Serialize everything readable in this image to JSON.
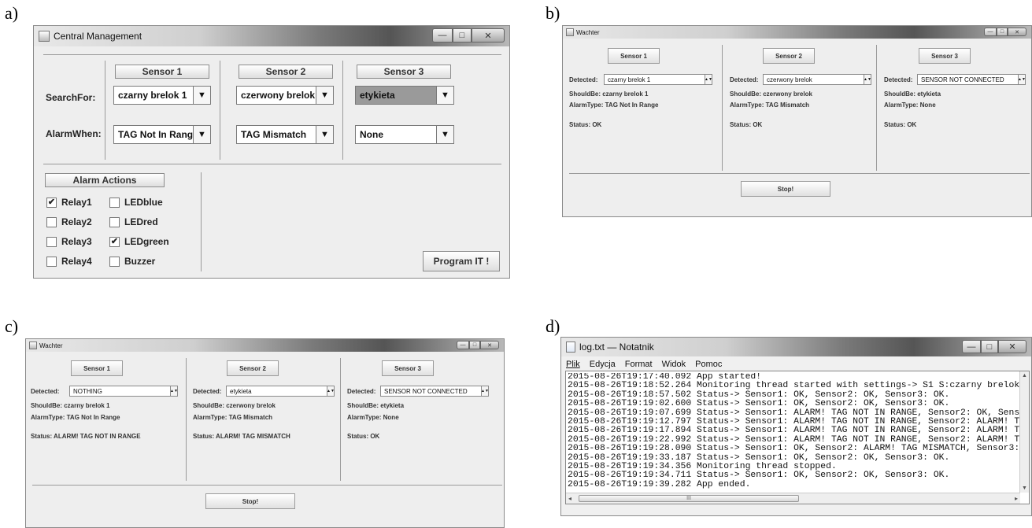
{
  "panels": {
    "a": "a)",
    "b": "b)",
    "c": "c)",
    "d": "d)"
  },
  "central": {
    "title": "Central Management",
    "sensors": [
      {
        "label": "Sensor 1",
        "search": "czarny brelok 1",
        "alarm": "TAG Not In Range"
      },
      {
        "label": "Sensor 2",
        "search": "czerwony brelok",
        "alarm": "TAG Mismatch"
      },
      {
        "label": "Sensor 3",
        "search": "etykieta",
        "alarm": "None"
      }
    ],
    "search_for_label": "SearchFor:",
    "alarm_when_label": "AlarmWhen:",
    "alarm_actions_label": "Alarm Actions",
    "checkboxes": [
      {
        "label": "Relay1",
        "checked": true
      },
      {
        "label": "LEDblue",
        "checked": false
      },
      {
        "label": "Relay2",
        "checked": false
      },
      {
        "label": "LEDred",
        "checked": false
      },
      {
        "label": "Relay3",
        "checked": false
      },
      {
        "label": "LEDgreen",
        "checked": true
      },
      {
        "label": "Relay4",
        "checked": false
      },
      {
        "label": "Buzzer",
        "checked": false
      }
    ],
    "program_label": "Program IT !"
  },
  "wachter_b": {
    "title": "Wachter",
    "stop_label": "Stop!",
    "columns": [
      {
        "sensor": "Sensor 1",
        "detected_label": "Detected:",
        "detected": "czarny brelok 1",
        "shouldbe": "ShouldBe:  czarny brelok 1",
        "alarmtype": "AlarmType:   TAG Not In Range",
        "status": "Status:  OK"
      },
      {
        "sensor": "Sensor 2",
        "detected_label": "Detected:",
        "detected": "czerwony brelok",
        "shouldbe": "ShouldBe: czerwony brelok",
        "alarmtype": "AlarmType:   TAG Mismatch",
        "status": "Status:  OK"
      },
      {
        "sensor": "Sensor 3",
        "detected_label": "Detected:",
        "detected": "SENSOR NOT CONNECTED",
        "shouldbe": "ShouldBe:  etykieta",
        "alarmtype": "AlarmType:   None",
        "status": "Status:  OK"
      }
    ]
  },
  "wachter_c": {
    "title": "Wachter",
    "stop_label": "Stop!",
    "columns": [
      {
        "sensor": "Sensor 1",
        "detected_label": "Detected:",
        "detected": "NOTHING",
        "shouldbe": "ShouldBe:  czarny brelok 1",
        "alarmtype": "AlarmType:   TAG Not In Range",
        "status": "Status:  ALARM! TAG NOT IN RANGE"
      },
      {
        "sensor": "Sensor 2",
        "detected_label": "Detected:",
        "detected": "etykieta",
        "shouldbe": "ShouldBe: czerwony brelok",
        "alarmtype": "AlarmType:   TAG Mismatch",
        "status": "Status:  ALARM! TAG MISMATCH"
      },
      {
        "sensor": "Sensor 3",
        "detected_label": "Detected:",
        "detected": "SENSOR NOT CONNECTED",
        "shouldbe": "ShouldBe:  etykieta",
        "alarmtype": "AlarmType:   None",
        "status": "Status:  OK"
      }
    ]
  },
  "notepad": {
    "title": "log.txt — Notatnik",
    "menu": [
      "Plik",
      "Edycja",
      "Format",
      "Widok",
      "Pomoc"
    ],
    "lines": [
      "2015-08-26T19:17:40.092 App started!",
      "2015-08-26T19:18:52.264 Monitoring thread started with settings-> S1 S:czarny brelok",
      "2015-08-26T19:18:57.502 Status-> Sensor1: OK, Sensor2: OK, Sensor3: OK.",
      "2015-08-26T19:19:02.600 Status-> Sensor1: OK, Sensor2: OK, Sensor3: OK.",
      "2015-08-26T19:19:07.699 Status-> Sensor1: ALARM! TAG NOT IN RANGE, Sensor2: OK, Sens",
      "2015-08-26T19:19:12.797 Status-> Sensor1: ALARM! TAG NOT IN RANGE, Sensor2: ALARM! T",
      "2015-08-26T19:19:17.894 Status-> Sensor1: ALARM! TAG NOT IN RANGE, Sensor2: ALARM! T",
      "2015-08-26T19:19:22.992 Status-> Sensor1: ALARM! TAG NOT IN RANGE, Sensor2: ALARM! T",
      "2015-08-26T19:19:28.090 Status-> Sensor1: OK, Sensor2: ALARM! TAG MISMATCH, Sensor3:",
      "2015-08-26T19:19:33.187 Status-> Sensor1: OK, Sensor2: OK, Sensor3: OK.",
      "2015-08-26T19:19:34.356 Monitoring thread stopped.",
      "2015-08-26T19:19:34.711 Status-> Sensor1: OK, Sensor2: OK, Sensor3: OK.",
      "2015-08-26T19:19:39.282 App ended."
    ],
    "scroll_mid": "III"
  }
}
